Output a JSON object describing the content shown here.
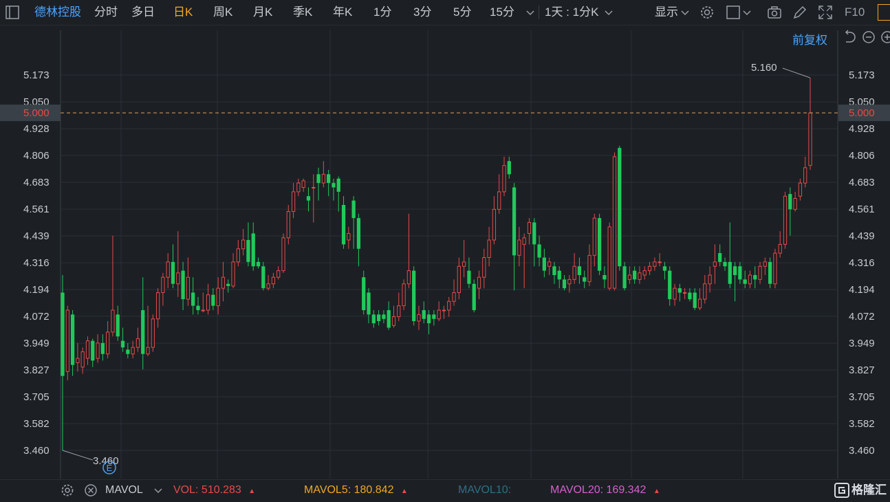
{
  "toolbar": {
    "stock_name": "德林控股",
    "periods": [
      "分时",
      "多日",
      "日K",
      "周K",
      "月K",
      "季K",
      "年K",
      "1分",
      "3分",
      "5分",
      "15分"
    ],
    "active_period": "日K",
    "interval_select": "1天 : 1分K",
    "display_label": "显示",
    "f10_label": "F10"
  },
  "subbar": {
    "adjust_label": "前复权"
  },
  "colors": {
    "up": "#e84a4a",
    "down": "#21c95b",
    "price_line": "#e0a060",
    "bg": "#1c2024",
    "grid": "#2b3037",
    "accent_blue": "#4aa3ff"
  },
  "chart_data": {
    "type": "candlestick",
    "y_ticks": [
      "5.173",
      "5.050",
      "4.928",
      "4.806",
      "4.683",
      "4.561",
      "4.439",
      "4.316",
      "4.194",
      "4.072",
      "3.949",
      "3.827",
      "3.705",
      "3.582",
      "3.460"
    ],
    "ylim": [
      3.4,
      5.25
    ],
    "current_price": "5.000",
    "max_label": "5.160",
    "min_label": "3.460",
    "event_marker": "E",
    "candles": [
      [
        4.18,
        3.8,
        4.26,
        3.46
      ],
      [
        3.82,
        4.1,
        4.12,
        3.78
      ],
      [
        4.08,
        3.85,
        4.1,
        3.8
      ],
      [
        3.86,
        3.88,
        3.95,
        3.82
      ],
      [
        3.84,
        3.91,
        3.93,
        3.81
      ],
      [
        3.88,
        3.96,
        3.98,
        3.85
      ],
      [
        3.96,
        3.87,
        3.97,
        3.84
      ],
      [
        3.88,
        3.95,
        3.99,
        3.86
      ],
      [
        3.95,
        3.9,
        3.99,
        3.87
      ],
      [
        3.9,
        4.0,
        4.05,
        3.88
      ],
      [
        4.0,
        4.1,
        4.44,
        3.98
      ],
      [
        4.08,
        3.98,
        4.12,
        3.96
      ],
      [
        3.96,
        3.93,
        4.02,
        3.91
      ],
      [
        3.92,
        3.9,
        3.95,
        3.88
      ],
      [
        3.9,
        3.93,
        3.96,
        3.88
      ],
      [
        3.93,
        3.97,
        4.02,
        3.91
      ],
      [
        4.1,
        3.9,
        4.25,
        3.83
      ],
      [
        3.9,
        3.93,
        4.12,
        3.89
      ],
      [
        3.93,
        4.06,
        4.08,
        3.91
      ],
      [
        4.06,
        4.18,
        4.2,
        4.02
      ],
      [
        4.18,
        4.25,
        4.27,
        4.12
      ],
      [
        4.25,
        4.32,
        4.36,
        4.2
      ],
      [
        4.32,
        4.22,
        4.4,
        4.2
      ],
      [
        4.22,
        4.27,
        4.46,
        4.16
      ],
      [
        4.28,
        4.15,
        4.32,
        4.1
      ],
      [
        4.15,
        4.25,
        4.34,
        4.12
      ],
      [
        4.18,
        4.12,
        4.25,
        4.08
      ],
      [
        4.12,
        4.1,
        4.16,
        4.08
      ],
      [
        4.1,
        4.1,
        4.18,
        4.09
      ],
      [
        4.1,
        4.17,
        4.22,
        4.08
      ],
      [
        4.17,
        4.12,
        4.2,
        4.1
      ],
      [
        4.12,
        4.2,
        4.25,
        4.08
      ],
      [
        4.2,
        4.25,
        4.32,
        4.14
      ],
      [
        4.22,
        4.21,
        4.24,
        4.18
      ],
      [
        4.21,
        4.32,
        4.36,
        4.2
      ],
      [
        4.32,
        4.38,
        4.42,
        4.3
      ],
      [
        4.38,
        4.42,
        4.47,
        4.35
      ],
      [
        4.42,
        4.32,
        4.5,
        4.3
      ],
      [
        4.45,
        4.3,
        4.5,
        4.28
      ],
      [
        4.32,
        4.3,
        4.34,
        4.29
      ],
      [
        4.3,
        4.2,
        4.32,
        4.19
      ],
      [
        4.2,
        4.22,
        4.26,
        4.19
      ],
      [
        4.22,
        4.25,
        4.27,
        4.2
      ],
      [
        4.25,
        4.28,
        4.3,
        4.24
      ],
      [
        4.28,
        4.43,
        4.45,
        4.27
      ],
      [
        4.43,
        4.55,
        4.58,
        4.4
      ],
      [
        4.55,
        4.64,
        4.68,
        4.52
      ],
      [
        4.64,
        4.68,
        4.7,
        4.62
      ],
      [
        4.66,
        4.69,
        4.7,
        4.64
      ],
      [
        4.62,
        4.6,
        4.66,
        4.55
      ],
      [
        4.66,
        4.66,
        4.72,
        4.5
      ],
      [
        4.72,
        4.68,
        4.75,
        4.6
      ],
      [
        4.68,
        4.72,
        4.78,
        4.66
      ],
      [
        4.72,
        4.68,
        4.74,
        4.62
      ],
      [
        4.68,
        4.66,
        4.7,
        4.6
      ],
      [
        4.7,
        4.64,
        4.71,
        4.55
      ],
      [
        4.58,
        4.4,
        4.62,
        4.38
      ],
      [
        4.42,
        4.45,
        4.48,
        4.38
      ],
      [
        4.6,
        4.52,
        4.62,
        4.38
      ],
      [
        4.52,
        4.38,
        4.54,
        4.3
      ],
      [
        4.25,
        4.1,
        4.28,
        4.08
      ],
      [
        4.18,
        4.08,
        4.2,
        4.04
      ],
      [
        4.08,
        4.04,
        4.1,
        4.02
      ],
      [
        4.08,
        4.05,
        4.1,
        4.03
      ],
      [
        4.08,
        4.06,
        4.1,
        4.04
      ],
      [
        4.1,
        4.02,
        4.14,
        4.01
      ],
      [
        4.03,
        4.07,
        4.12,
        4.02
      ],
      [
        4.07,
        4.12,
        4.18,
        4.05
      ],
      [
        4.12,
        4.22,
        4.24,
        4.1
      ],
      [
        4.22,
        4.28,
        4.54,
        4.2
      ],
      [
        4.28,
        4.05,
        4.3,
        4.03
      ],
      [
        4.05,
        4.08,
        4.12,
        4.01
      ],
      [
        4.1,
        4.06,
        4.14,
        4.04
      ],
      [
        4.08,
        4.04,
        4.1,
        3.99
      ],
      [
        4.08,
        4.06,
        4.1,
        4.03
      ],
      [
        4.06,
        4.1,
        4.14,
        4.05
      ],
      [
        4.1,
        4.1,
        4.12,
        4.06
      ],
      [
        4.1,
        4.14,
        4.16,
        4.07
      ],
      [
        4.14,
        4.18,
        4.24,
        4.12
      ],
      [
        4.18,
        4.3,
        4.34,
        4.15
      ],
      [
        4.3,
        4.32,
        4.42,
        4.25
      ],
      [
        4.28,
        4.22,
        4.34,
        4.2
      ],
      [
        4.22,
        4.1,
        4.24,
        4.09
      ],
      [
        4.2,
        4.25,
        4.28,
        4.15
      ],
      [
        4.25,
        4.34,
        4.38,
        4.2
      ],
      [
        4.34,
        4.42,
        4.48,
        4.3
      ],
      [
        4.42,
        4.56,
        4.62,
        4.4
      ],
      [
        4.56,
        4.64,
        4.72,
        4.54
      ],
      [
        4.64,
        4.76,
        4.8,
        4.62
      ],
      [
        4.78,
        4.72,
        4.8,
        4.7
      ],
      [
        4.66,
        4.35,
        4.68,
        4.19
      ],
      [
        4.35,
        4.42,
        4.48,
        4.3
      ],
      [
        4.4,
        4.43,
        4.45,
        4.2
      ],
      [
        4.45,
        4.5,
        4.52,
        4.4
      ],
      [
        4.5,
        4.4,
        4.52,
        4.3
      ],
      [
        4.4,
        4.34,
        4.44,
        4.3
      ],
      [
        4.34,
        4.28,
        4.38,
        4.25
      ],
      [
        4.3,
        4.32,
        4.34,
        4.26
      ],
      [
        4.3,
        4.26,
        4.32,
        4.22
      ],
      [
        4.28,
        4.24,
        4.3,
        4.2
      ],
      [
        4.24,
        4.2,
        4.26,
        4.19
      ],
      [
        4.22,
        4.24,
        4.26,
        4.18
      ],
      [
        4.24,
        4.3,
        4.36,
        4.22
      ],
      [
        4.3,
        4.26,
        4.34,
        4.22
      ],
      [
        4.25,
        4.23,
        4.28,
        4.2
      ],
      [
        4.23,
        4.35,
        4.4,
        4.21
      ],
      [
        4.35,
        4.52,
        4.54,
        4.3
      ],
      [
        4.52,
        4.28,
        4.54,
        4.26
      ],
      [
        4.26,
        4.24,
        4.3,
        4.2
      ],
      [
        4.2,
        4.48,
        4.5,
        4.19
      ],
      [
        4.2,
        4.8,
        4.82,
        4.19
      ],
      [
        4.84,
        4.3,
        4.85,
        4.28
      ],
      [
        4.3,
        4.2,
        4.32,
        4.19
      ],
      [
        4.24,
        4.26,
        4.3,
        4.22
      ],
      [
        4.28,
        4.24,
        4.3,
        4.22
      ],
      [
        4.24,
        4.27,
        4.3,
        4.22
      ],
      [
        4.26,
        4.28,
        4.3,
        4.24
      ],
      [
        4.28,
        4.3,
        4.32,
        4.26
      ],
      [
        4.3,
        4.32,
        4.34,
        4.28
      ],
      [
        4.32,
        4.32,
        4.36,
        4.3
      ],
      [
        4.3,
        4.28,
        4.32,
        4.24
      ],
      [
        4.28,
        4.15,
        4.3,
        4.12
      ],
      [
        4.15,
        4.2,
        4.22,
        4.12
      ],
      [
        4.2,
        4.18,
        4.22,
        4.14
      ],
      [
        4.18,
        4.18,
        4.2,
        4.15
      ],
      [
        4.18,
        4.15,
        4.2,
        4.14
      ],
      [
        4.18,
        4.11,
        4.2,
        4.1
      ],
      [
        4.11,
        4.15,
        4.2,
        4.1
      ],
      [
        4.15,
        4.22,
        4.26,
        4.13
      ],
      [
        4.22,
        4.26,
        4.3,
        4.18
      ],
      [
        4.3,
        4.32,
        4.4,
        4.22
      ],
      [
        4.36,
        4.32,
        4.4,
        4.3
      ],
      [
        4.32,
        4.3,
        4.34,
        4.28
      ],
      [
        4.32,
        4.22,
        4.5,
        4.2
      ],
      [
        4.3,
        4.26,
        4.32,
        4.14
      ],
      [
        4.3,
        4.24,
        4.32,
        4.22
      ],
      [
        4.24,
        4.22,
        4.28,
        4.2
      ],
      [
        4.22,
        4.26,
        4.28,
        4.2
      ],
      [
        4.26,
        4.24,
        4.3,
        4.2
      ],
      [
        4.24,
        4.3,
        4.32,
        4.22
      ],
      [
        4.3,
        4.32,
        4.34,
        4.26
      ],
      [
        4.32,
        4.22,
        4.34,
        4.2
      ],
      [
        4.22,
        4.36,
        4.38,
        4.2
      ],
      [
        4.36,
        4.4,
        4.46,
        4.34
      ],
      [
        4.4,
        4.62,
        4.64,
        4.38
      ],
      [
        4.63,
        4.56,
        4.66,
        4.44
      ],
      [
        4.56,
        4.61,
        4.64,
        4.55
      ],
      [
        4.62,
        4.68,
        4.7,
        4.6
      ],
      [
        4.68,
        4.75,
        4.8,
        4.66
      ],
      [
        4.76,
        5.0,
        5.16,
        4.74
      ]
    ]
  },
  "bottombar": {
    "indicator": "MAVOL",
    "vol_label": "VOL:",
    "vol_value": "510.283",
    "mavol5_label": "MAVOL5:",
    "mavol5_value": "180.842",
    "mavol10_label": "MAVOL10:",
    "mavol20_label": "MAVOL20:",
    "mavol20_value": "169.342",
    "logo_text": "格隆汇"
  }
}
